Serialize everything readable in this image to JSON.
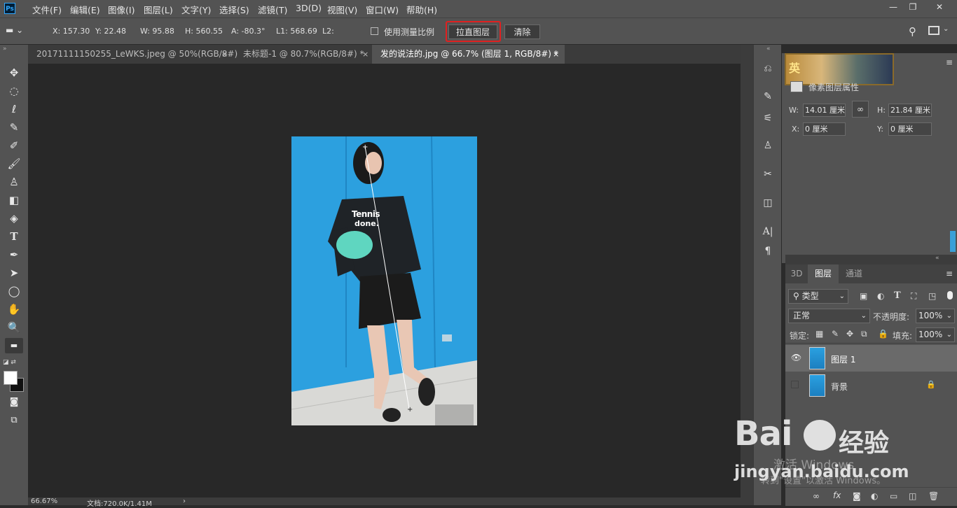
{
  "menubar": {
    "logo": "Ps",
    "items": [
      "文件(F)",
      "编辑(E)",
      "图像(I)",
      "图层(L)",
      "文字(Y)",
      "选择(S)",
      "滤镜(T)",
      "3D(D)",
      "视图(V)",
      "窗口(W)",
      "帮助(H)"
    ],
    "window_controls": [
      "—",
      "❐",
      "✕"
    ]
  },
  "options": {
    "x": "X: 157.30",
    "y": "Y: 22.48",
    "w": "W: 95.88",
    "h": "H: 560.55",
    "angle": "A: -80.3°",
    "l1": "L1: 568.69",
    "l2": "L2:",
    "use_scale_label": "使用测量比例",
    "straighten_label": "拉直图层",
    "clear_label": "清除"
  },
  "tabs": [
    {
      "label": "20171111150255_LeWKS.jpeg @ 50%(RGB/8#)",
      "close": "×"
    },
    {
      "label": "未标题-1 @ 80.7%(RGB/8#) *",
      "close": "×"
    },
    {
      "label": "发的说法的.jpg @ 66.7% (图层 1, RGB/8#) *",
      "close": "×"
    }
  ],
  "photo": {
    "shirt_text_1": "Tennis",
    "shirt_text_2": "done."
  },
  "status": {
    "zoom": "66.67%",
    "doc": "文档:720.0K/1.41M",
    "arrow": "›"
  },
  "properties": {
    "title": "像素图层属性",
    "w_label": "W:",
    "w_value": "14.01 厘米",
    "h_label": "H:",
    "h_value": "21.84 厘米",
    "x_label": "X:",
    "x_value": "0 厘米",
    "y_label": "Y:",
    "y_value": "0 厘米"
  },
  "layers_panel": {
    "tabs": [
      "3D",
      "图层",
      "通道"
    ],
    "filter_kind": "类型",
    "blend_mode": "正常",
    "opacity_label": "不透明度:",
    "opacity_value": "100%",
    "lock_label": "锁定:",
    "fill_label": "填充:",
    "fill_value": "100%",
    "layers": [
      {
        "name": "图层 1",
        "visible": true,
        "selected": true
      },
      {
        "name": "背景",
        "visible": false,
        "locked": true
      }
    ]
  },
  "watermark": {
    "brand": "Bai",
    "brand2": "经验",
    "url": "jingyan.baidu.com",
    "activate1": "激活 Windows",
    "activate2": "转到\"设置\"以激活 Windows。"
  },
  "colors": {
    "accent_red": "#e02020",
    "ui_gray": "#535353",
    "canvas_bg": "#282828"
  }
}
